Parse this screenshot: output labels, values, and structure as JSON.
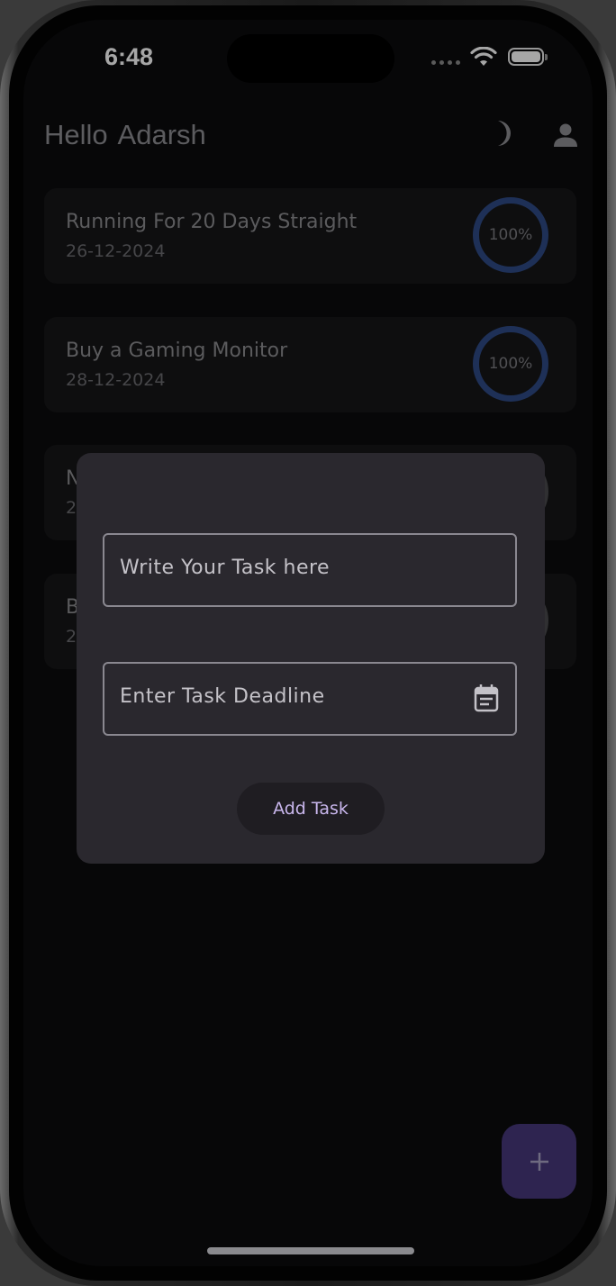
{
  "status_bar": {
    "time": "6:48"
  },
  "header": {
    "greeting": "Hello  Adarsh"
  },
  "icons": {
    "theme_toggle": "moon-icon",
    "profile": "person-icon",
    "calendar": "calendar-icon",
    "fab": "plus-icon"
  },
  "tasks": [
    {
      "title": "Running For 20 Days Straight",
      "date": "26-12-2024",
      "progress_label": "100%",
      "progress": 1.0
    },
    {
      "title": "Buy a Gaming Monitor",
      "date": "28-12-2024",
      "progress_label": "100%",
      "progress": 1.0
    },
    {
      "title": "N",
      "date": "2"
    },
    {
      "title": "B",
      "date": "2"
    }
  ],
  "dialog": {
    "task_placeholder": "Write Your Task here",
    "deadline_placeholder": "Enter Task Deadline",
    "add_button": "Add Task"
  },
  "fab": {
    "label": "+"
  },
  "colors": {
    "background": "#0b0b0d",
    "card": "#161618",
    "dialog": "#2a282e",
    "progress_ring": "#2f4b86",
    "accent_text": "#c8b6ec",
    "fab": "#2e2450"
  }
}
